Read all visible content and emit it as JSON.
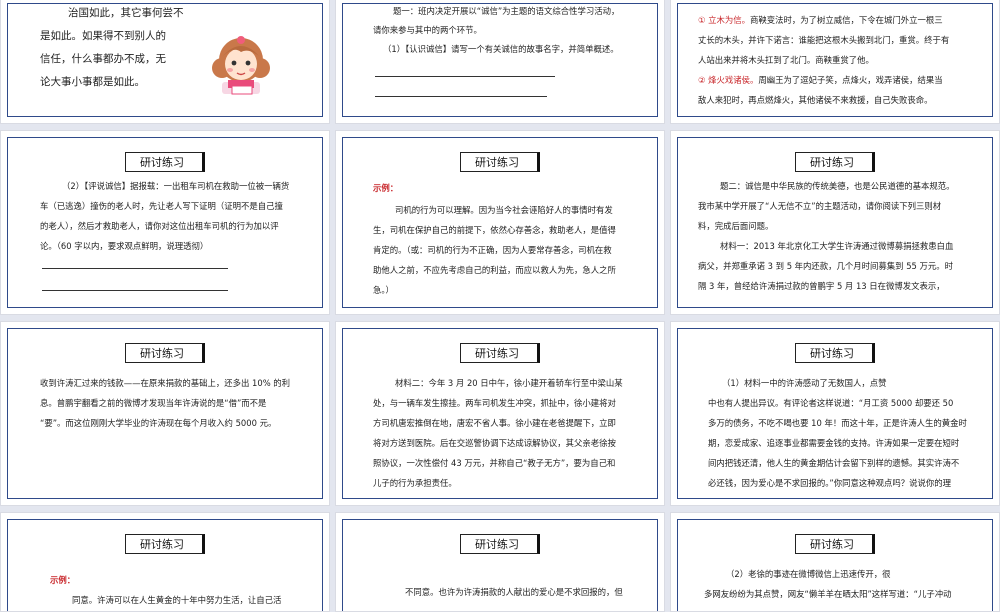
{
  "slides": {
    "s1": {
      "lines": [
        "治国如此，其它事何尝不",
        "是如此。如果得不到别人的",
        "信任，什么事都办不成，无",
        "论大事小事都是如此。"
      ]
    },
    "s2": {
      "q": "题一：班内决定开展以“诚信”为主题的语文综合性学习活动，",
      "q2": "请你来参与其中的两个环节。",
      "sub": "（1）【认识诚信】请写一个有关诚信的故事名字，并简单概述。"
    },
    "s3": {
      "l1_red": "① 立木为信。",
      "l1": "商鞅变法时，为了树立威信，下令在城门外立一根三",
      "l2": "丈长的木头，并许下诺言：谁能把这根木头搬到北门，重赏。终于有",
      "l3": "人站出来并将木头扛到了北门。商鞅重赏了他。",
      "l4_red": "② 烽火戏诸侯。",
      "l4": "周幽王为了逗妃子笑，点烽火，戏弄诸侯，结果当",
      "l5": "敌人来犯时，再点燃烽火，其他诸侯不来救援，自己失败丧命。"
    },
    "s4": {
      "header": "研讨练习",
      "lines": [
        "（2）【评说诚信】据报载：一出租车司机在救助一位被一辆货",
        "车（已逃逸）撞伤的老人时，先让老人写下证明（证明不是自己撞",
        "的老人），然后才救助老人，请你对这位出租车司机的行为加以评",
        "论。（60 字以内，要求观点鲜明，说理透彻）"
      ]
    },
    "s5": {
      "header": "研讨练习",
      "example": "示例：",
      "lines": [
        "司机的行为可以理解。因为当今社会诬陷好人的事情时有发",
        "生，司机在保护自己的前提下，依然心存善念，救助老人，是值得",
        "肯定的。（或：司机的行为不正确，因为人要常存善念，司机在救",
        "助他人之前，不应先考虑自己的利益，而应以救人为先，急人之所",
        "急。）"
      ]
    },
    "s6": {
      "header": "研讨练习",
      "lines": [
        "题二：诚信是中华民族的传统美德，也是公民道德的基本规范。",
        "我市某中学开展了“人无信不立”的主题活动，请你阅读下列三则材",
        "料，完成后面问题。",
        "材料一：2013 年北京化工大学生许涛通过微博募捐拯救患白血",
        "病父，并郑重承诺 3 到 5 年内还款，几个月时间募集到 55 万元。时",
        "隔 3 年，曾经给许涛捐过款的曾鹏宇 5 月 13 日在微博发文表示，"
      ]
    },
    "s7": {
      "header": "研讨练习",
      "lines": [
        "收到许涛汇过来的钱款——在原来捐款的基础上，还多出 10% 的利",
        "息。曾鹏宇翻看之前的微博才发现当年许涛说的是“借”而不是",
        "“要”。而这位刚刚大学毕业的许涛现在每个月收入约 5000 元。"
      ]
    },
    "s8": {
      "header": "研讨练习",
      "lines": [
        "材料二：今年 3 月 20 日中午，徐小建开着轿车行至中梁山某",
        "处，与一辆车发生擦挂。两车司机发生冲突，抓扯中，徐小建将对",
        "方司机唐宏推倒在地，唐宏不省人事。徐小建在老爸提醒下，立即",
        "将对方送到医院。后在交巡警协调下达成谅解协议，其父亲老徐按",
        "照协议，一次性偿付 43 万元，并称自己“教子无方”，要为自己和",
        "儿子的行为承担责任。"
      ]
    },
    "s9": {
      "header": "研讨练习",
      "lines": [
        "（1）材料一中的许涛感动了无数国人，点赞",
        "中也有人提出异议。有评论者这样说道：“月工资 5000 却要还 50",
        "多万的债务，不吃不喝也要 10 年！而这十年，正是许涛人生的黄金时",
        "期，恋爱成家、追逐事业都需要金钱的支持。许涛如果一定要在短时",
        "间内把钱还清，他人生的黄金期估计会留下别样的遗憾。其实许涛不",
        "必还钱，因为爱心是不求回报的。”你同意这种观点吗？说说你的理",
        "由。"
      ]
    },
    "s10": {
      "header": "研讨练习",
      "example": "示例：",
      "line1": "同意。许涛可以在人生黄金的十年中努力生活，让自己活"
    },
    "s11": {
      "header": "研讨练习",
      "line1": "不同意。也许为许涛捐款的人献出的爱心是不求回报的，但"
    },
    "s12": {
      "header": "研讨练习",
      "l1": "（2）老徐的事迹在微博微信上迅速传开，很",
      "l2": "多网友纷纷为其点赞，网友“懒羊羊在晒太阳”这样写道：“儿子冲动"
    }
  }
}
